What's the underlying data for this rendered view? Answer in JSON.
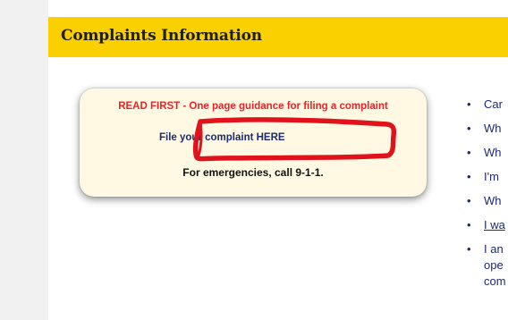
{
  "header": {
    "title": "Complaints Information"
  },
  "guidance_box": {
    "read_first": "READ FIRST - One page guidance for filing a complaint",
    "file_link": "File your complaint HERE",
    "emergency": "For emergencies, call 9-1-1."
  },
  "side_list": {
    "items": [
      {
        "text": "Car"
      },
      {
        "text": "Wh"
      },
      {
        "text": "Wh"
      },
      {
        "text": "I'm"
      },
      {
        "text": "Wh"
      },
      {
        "text": "I wa",
        "link": true
      },
      {
        "lines": [
          "I an",
          "ope",
          "com"
        ]
      }
    ]
  },
  "colors": {
    "header_bg": "#fad000",
    "box_bg": "#fff9e3",
    "read_first_red": "#e8242a",
    "link_navy": "#1e2a6e",
    "marker_red": "#e0121b"
  }
}
